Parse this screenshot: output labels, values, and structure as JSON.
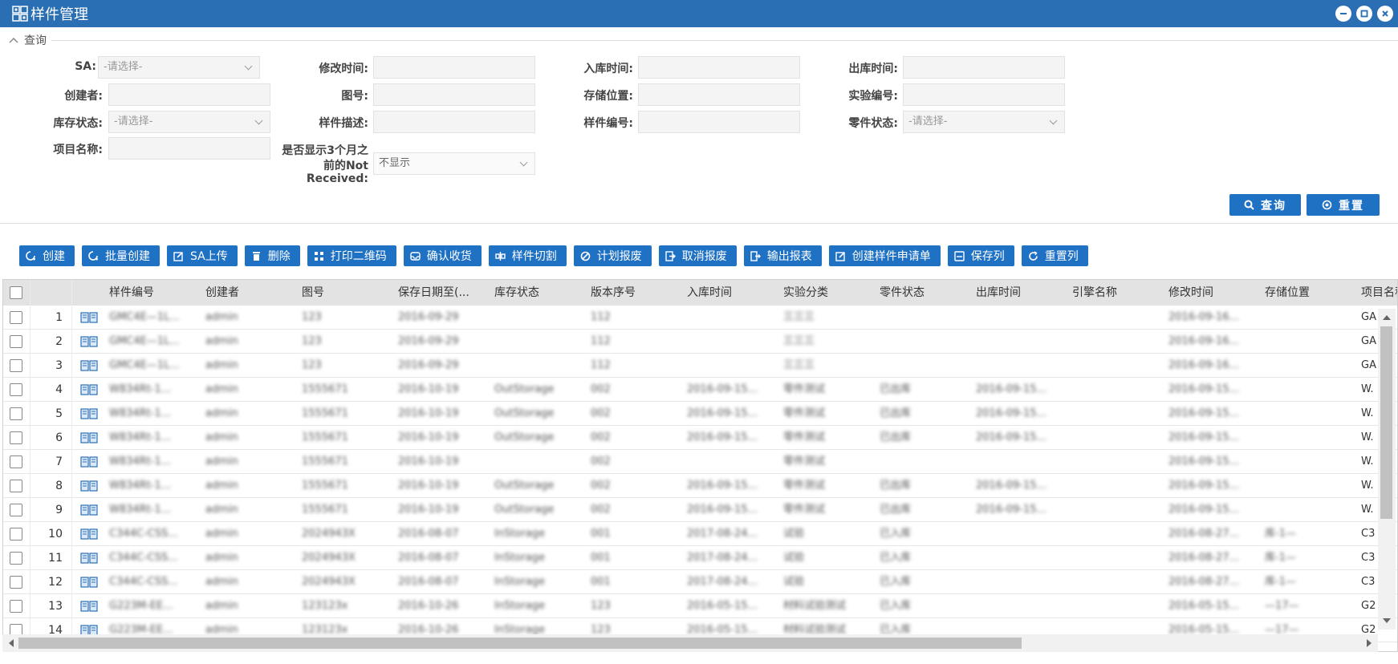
{
  "window": {
    "title": "样件管理"
  },
  "query": {
    "section_label": "查询",
    "fields": [
      {
        "label": "SA:",
        "value": "",
        "placeholder": "-请选择-",
        "type": "select"
      },
      {
        "label": "修改时间:",
        "value": "",
        "type": "text"
      },
      {
        "label": "入库时间:",
        "value": "",
        "type": "text"
      },
      {
        "label": "出库时间:",
        "value": "",
        "type": "text"
      },
      {
        "label": "创建者:",
        "value": "",
        "type": "text"
      },
      {
        "label": "图号:",
        "value": "",
        "type": "text"
      },
      {
        "label": "存储位置:",
        "value": "",
        "type": "text"
      },
      {
        "label": "实验编号:",
        "value": "",
        "type": "text"
      },
      {
        "label": "库存状态:",
        "value": "",
        "placeholder": "-请选择-",
        "type": "select"
      },
      {
        "label": "样件描述:",
        "value": "",
        "type": "text"
      },
      {
        "label": "样件编号:",
        "value": "",
        "type": "text"
      },
      {
        "label": "零件状态:",
        "value": "",
        "placeholder": "-请选择-",
        "type": "select"
      },
      {
        "label": "项目名称:",
        "value": "",
        "type": "text"
      }
    ],
    "show_not_received": {
      "label_line1": "是否显示3个月之",
      "label_line2": "前的Not",
      "label_line3": "Received:",
      "value": "不显示"
    },
    "search_label": "查询",
    "reset_label": "重置"
  },
  "toolbar": {
    "buttons": [
      {
        "label": "创建",
        "icon": "create-icon"
      },
      {
        "label": "批量创建",
        "icon": "batch-create-icon"
      },
      {
        "label": "SA上传",
        "icon": "edit-icon"
      },
      {
        "label": "删除",
        "icon": "trash-icon"
      },
      {
        "label": "打印二维码",
        "icon": "qrcode-icon"
      },
      {
        "label": "确认收货",
        "icon": "inbox-icon"
      },
      {
        "label": "样件切割",
        "icon": "cut-icon"
      },
      {
        "label": "计划报废",
        "icon": "ban-icon"
      },
      {
        "label": "取消报废",
        "icon": "export-icon"
      },
      {
        "label": "输出报表",
        "icon": "output-icon"
      },
      {
        "label": "创建样件申请单",
        "icon": "edit-icon"
      },
      {
        "label": "保存列",
        "icon": "save-icon"
      },
      {
        "label": "重置列",
        "icon": "refresh-icon"
      }
    ]
  },
  "grid": {
    "columns": [
      "样件编号",
      "创建者",
      "图号",
      "保存日期至(...",
      "库存状态",
      "版本序号",
      "入库时间",
      "实验分类",
      "零件状态",
      "出库时间",
      "引擎名称",
      "修改时间",
      "存储位置",
      "项目名称"
    ],
    "rows": [
      {
        "num": "1",
        "cells": [
          "GMC4E—1L...",
          "admin",
          "123",
          "2016-09-29",
          "",
          "112",
          "",
          "三三三",
          "",
          "",
          "",
          "2016-09-16...",
          "",
          "GA"
        ]
      },
      {
        "num": "2",
        "cells": [
          "GMC4E—1L...",
          "admin",
          "123",
          "2016-09-29",
          "",
          "112",
          "",
          "三三三",
          "",
          "",
          "",
          "2016-09-16...",
          "",
          "GA"
        ]
      },
      {
        "num": "3",
        "cells": [
          "GMC4E—1L...",
          "admin",
          "123",
          "2016-09-29",
          "",
          "112",
          "",
          "三三三",
          "",
          "",
          "",
          "2016-09-16...",
          "",
          "GA"
        ]
      },
      {
        "num": "4",
        "cells": [
          "W834Rt-1...",
          "admin",
          "1555671",
          "2016-10-19",
          "OutStorage",
          "002",
          "2016-09-15...",
          "零件测试",
          "已出库",
          "2016-09-15...",
          "",
          "2016-09-15...",
          "",
          "W."
        ]
      },
      {
        "num": "5",
        "cells": [
          "W834Rt-1...",
          "admin",
          "1555671",
          "2016-10-19",
          "OutStorage",
          "002",
          "2016-09-15...",
          "零件测试",
          "已出库",
          "2016-09-15...",
          "",
          "2016-09-15...",
          "",
          "W."
        ]
      },
      {
        "num": "6",
        "cells": [
          "W834Rt-1...",
          "admin",
          "1555671",
          "2016-10-19",
          "OutStorage",
          "002",
          "2016-09-15...",
          "零件测试",
          "已出库",
          "2016-09-15...",
          "",
          "2016-09-15...",
          "",
          "W."
        ]
      },
      {
        "num": "7",
        "cells": [
          "W834Rt-1...",
          "admin",
          "1555671",
          "2016-10-19",
          "",
          "002",
          "",
          "零件测试",
          "",
          "",
          "",
          "2016-09-15...",
          "",
          "W."
        ]
      },
      {
        "num": "8",
        "cells": [
          "W834Rt-1...",
          "admin",
          "1555671",
          "2016-10-19",
          "OutStorage",
          "002",
          "2016-09-15...",
          "零件测试",
          "已出库",
          "2016-09-15...",
          "",
          "2016-09-15...",
          "",
          "W."
        ]
      },
      {
        "num": "9",
        "cells": [
          "W834Rt-1...",
          "admin",
          "1555671",
          "2016-10-19",
          "OutStorage",
          "002",
          "2016-09-15...",
          "零件测试",
          "已出库",
          "2016-09-15...",
          "",
          "2016-09-15...",
          "",
          "W."
        ]
      },
      {
        "num": "10",
        "cells": [
          "C344C-CSS...",
          "admin",
          "2024943X",
          "2016-08-07",
          "InStorage",
          "001",
          "2017-08-24...",
          "试验",
          "已入库",
          "",
          "",
          "2016-08-27...",
          "库-1—",
          "C3"
        ]
      },
      {
        "num": "11",
        "cells": [
          "C344C-CSS...",
          "admin",
          "2024943X",
          "2016-08-07",
          "InStorage",
          "001",
          "2017-08-24...",
          "试验",
          "已入库",
          "",
          "",
          "2016-08-27...",
          "库-1—",
          "C3"
        ]
      },
      {
        "num": "12",
        "cells": [
          "C344C-CSS...",
          "admin",
          "2024943X",
          "2016-08-07",
          "InStorage",
          "001",
          "2017-08-24...",
          "试验",
          "已入库",
          "",
          "",
          "2016-08-27...",
          "库-1—",
          "C3"
        ]
      },
      {
        "num": "13",
        "cells": [
          "G223M-EE...",
          "admin",
          "123123x",
          "2016-10-26",
          "InStorage",
          "123",
          "2016-05-15...",
          "材料试验测试",
          "已入库",
          "",
          "",
          "2016-05-15...",
          "—17—",
          "G2"
        ]
      },
      {
        "num": "14",
        "cells": [
          "G223M-EE...",
          "admin",
          "123123x",
          "2016-10-26",
          "InStorage",
          "123",
          "2016-05-15...",
          "材料试验测试",
          "已入库",
          "",
          "",
          "2016-05-15...",
          "—17—",
          "G2"
        ]
      }
    ]
  },
  "colors": {
    "titlebar": "#2a6fb4",
    "button": "#1f71c4",
    "header_bg": "#e3e3e3"
  }
}
